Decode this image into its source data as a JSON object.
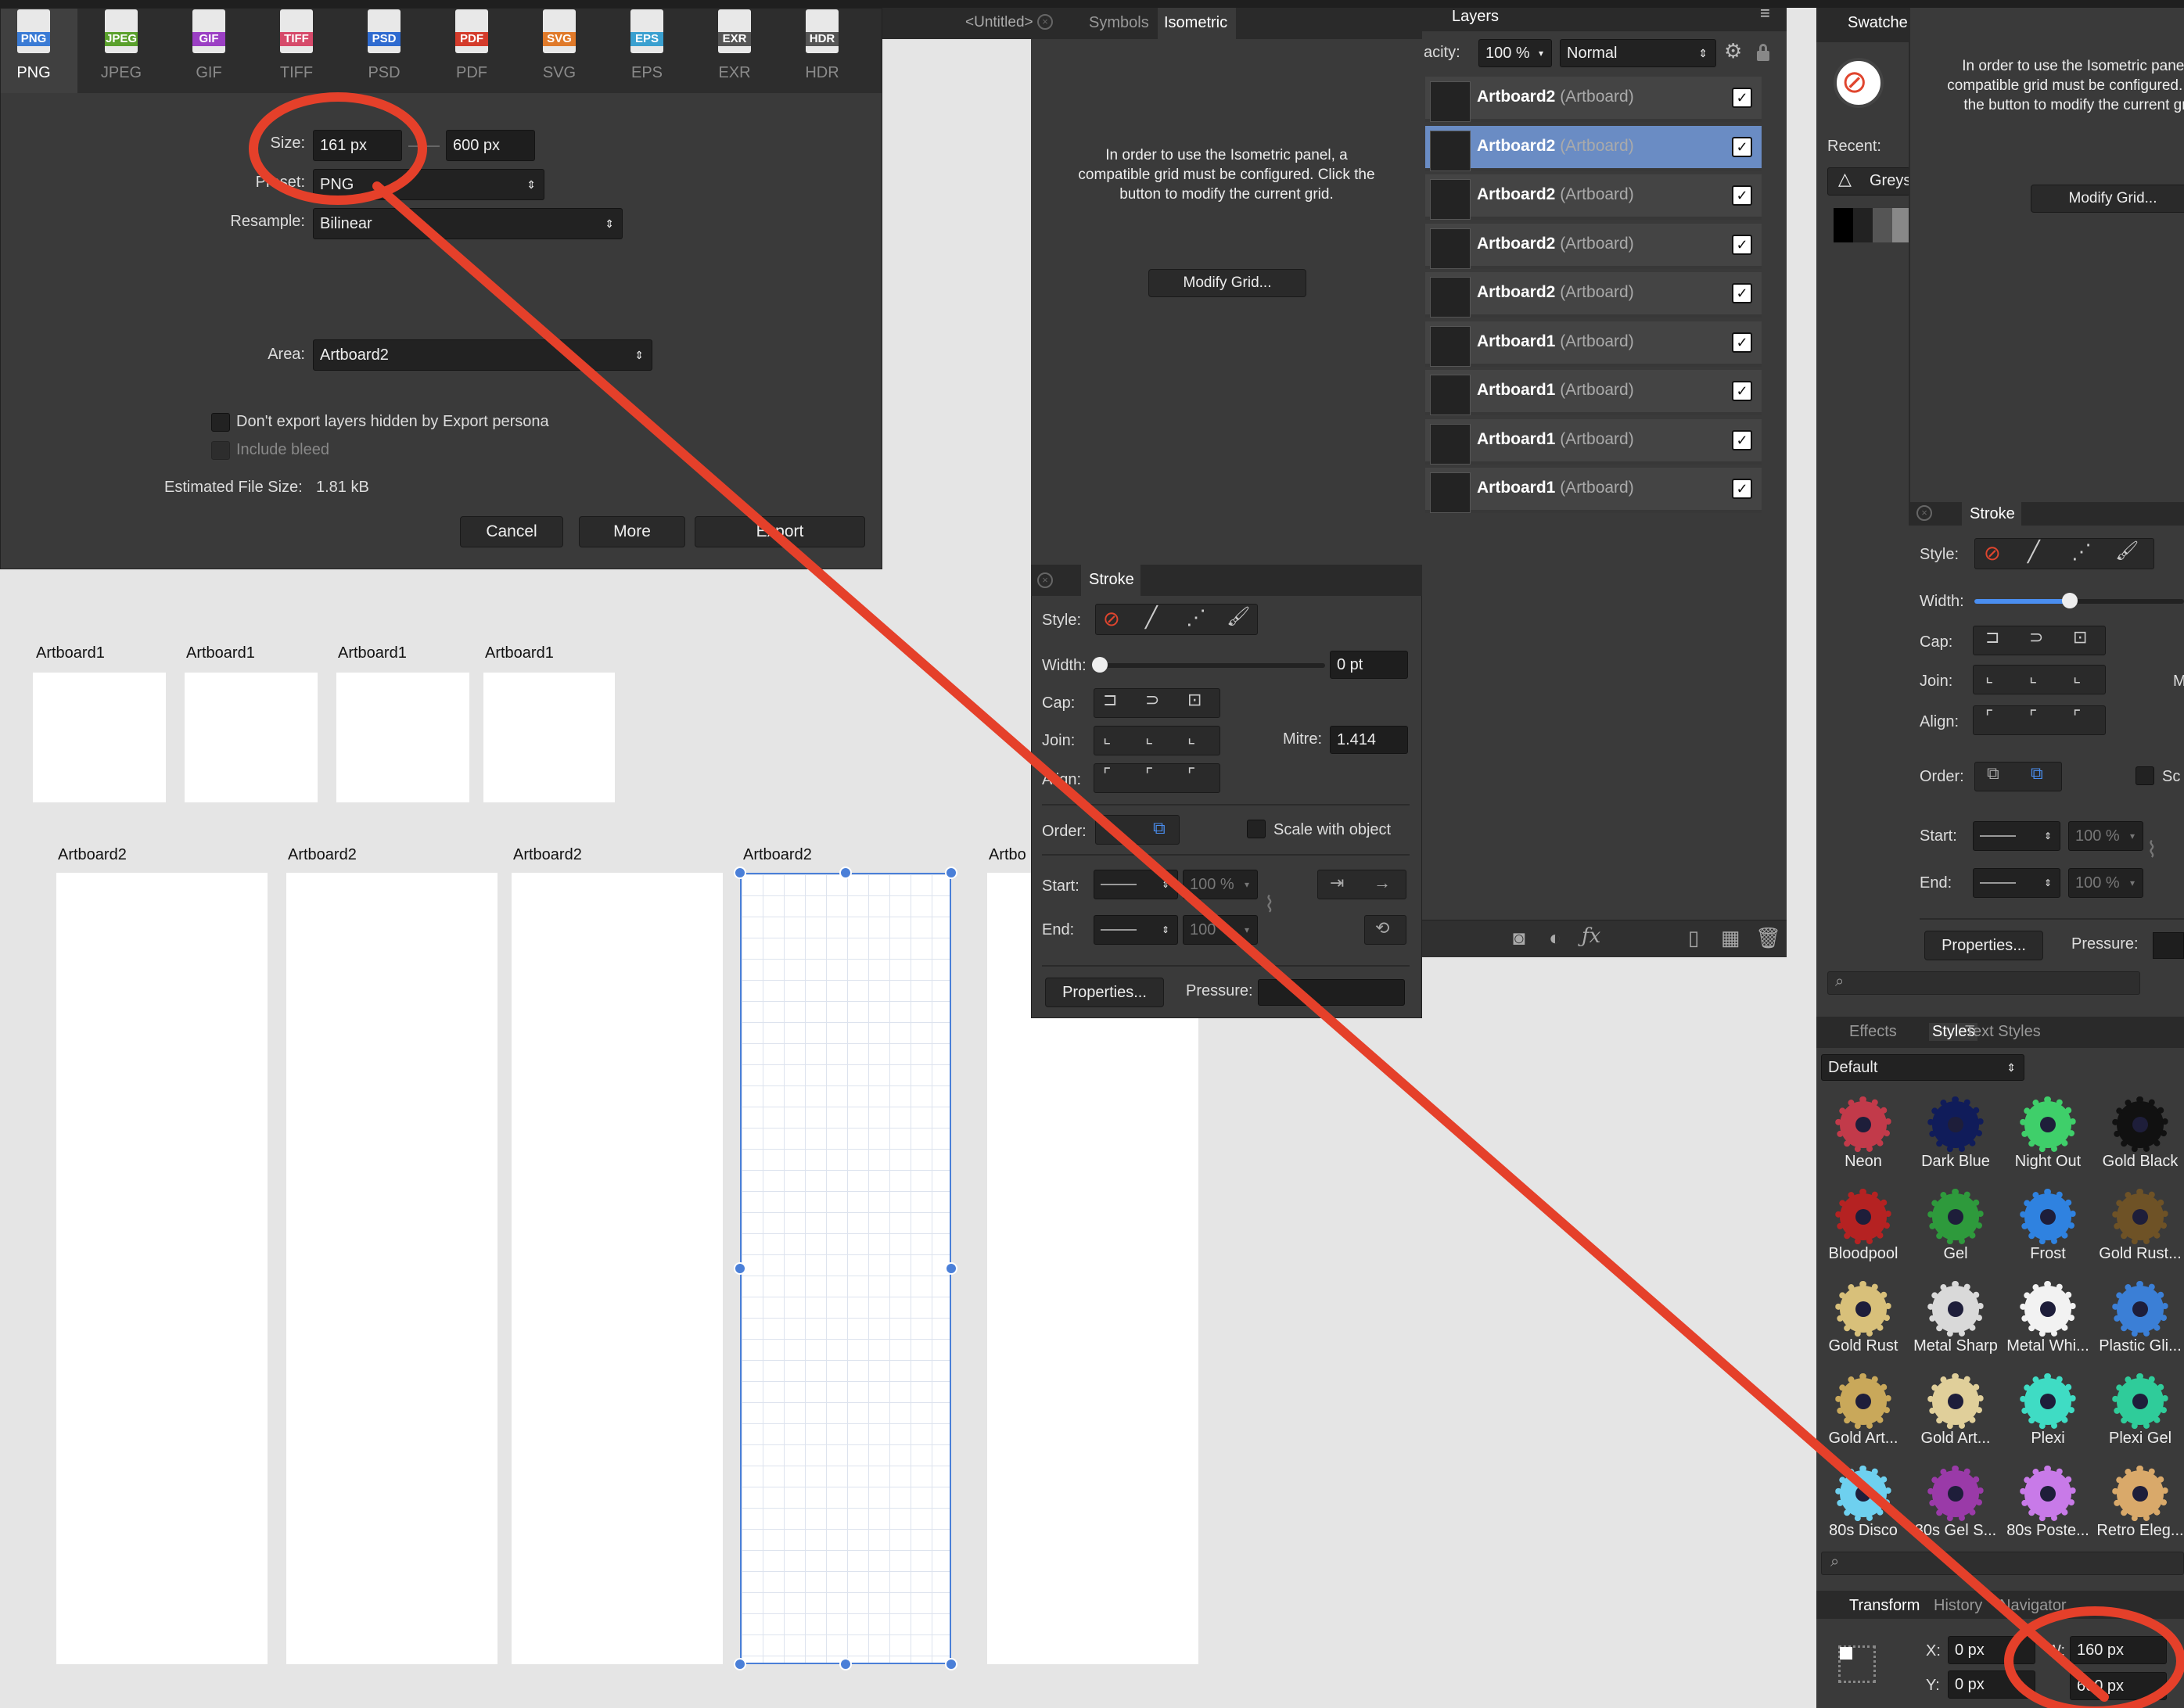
{
  "export_dialog": {
    "formats": [
      "PNG",
      "JPEG",
      "GIF",
      "TIFF",
      "PSD",
      "PDF",
      "SVG",
      "EPS",
      "EXR",
      "HDR"
    ],
    "size_label": "Size:",
    "width_value": "161 px",
    "height_value": "600 px",
    "preset_label": "Preset:",
    "preset_value": "PNG",
    "resample_label": "Resample:",
    "resample_value": "Bilinear",
    "area_label": "Area:",
    "area_value": "Artboard2",
    "hidden_layers_label": "Don't export layers hidden by Export persona",
    "include_bleed_label": "Include bleed",
    "file_size_label": "Estimated File Size:",
    "file_size_value": "1.81 kB",
    "cancel": "Cancel",
    "more": "More",
    "export": "Export"
  },
  "doc_tabs": {
    "untitled": "<Untitled>",
    "symbols": "Symbols",
    "isometric": "Isometric"
  },
  "isometric": {
    "message": "In order to use the Isometric panel, a compatible grid must be configured. Click the button to modify the current grid.",
    "modify_grid": "Modify Grid..."
  },
  "layers": {
    "title": "Layers",
    "opacity_label": "acity:",
    "opacity_value": "100 %",
    "blend_mode": "Normal",
    "rows": [
      {
        "name": "Artboard2",
        "type": "(Artboard)"
      },
      {
        "name": "Artboard2",
        "type": "(Artboard)"
      },
      {
        "name": "Artboard2",
        "type": "(Artboard)"
      },
      {
        "name": "Artboard2",
        "type": "(Artboard)"
      },
      {
        "name": "Artboard2",
        "type": "(Artboard)"
      },
      {
        "name": "Artboard1",
        "type": "(Artboard)"
      },
      {
        "name": "Artboard1",
        "type": "(Artboard)"
      },
      {
        "name": "Artboard1",
        "type": "(Artboard)"
      },
      {
        "name": "Artboard1",
        "type": "(Artboard)"
      }
    ],
    "selected_index": 1
  },
  "stroke": {
    "title": "Stroke",
    "style_label": "Style:",
    "width_label": "Width:",
    "width_value": "0 pt",
    "cap_label": "Cap:",
    "join_label": "Join:",
    "mitre_label": "Mitre:",
    "mitre_value": "1.414",
    "align_label": "Align:",
    "order_label": "Order:",
    "scale_label": "Scale with object",
    "start_label": "Start:",
    "end_label": "End:",
    "pct": "100 %",
    "pct_short": "100",
    "properties": "Properties...",
    "pressure_label": "Pressure:"
  },
  "right_stroke": {
    "title": "Stroke",
    "style_label": "Style:",
    "width_label": "Width:",
    "cap_label": "Cap:",
    "join_label": "Join:",
    "align_label": "Align:",
    "order_label": "Order:",
    "scale_label": "Sc",
    "m_label": "M",
    "start_label": "Start:",
    "end_label": "End:",
    "pct": "100 %",
    "properties": "Properties...",
    "pressure_label": "Pressure:"
  },
  "swatches": {
    "title": "Swatche",
    "recent_label": "Recent:",
    "palette": "Greys",
    "message": "In order to use the Isometric panel, a compatible grid must be configured. Click the button to modify the current grid.",
    "modify_grid": "Modify Grid..."
  },
  "styles": {
    "tabs": [
      "Effects",
      "Styles",
      "Text Styles"
    ],
    "category": "Default",
    "items": [
      {
        "name": "Neon",
        "color": "#c23a4a"
      },
      {
        "name": "Dark Blue",
        "color": "#101c5a"
      },
      {
        "name": "Night Out",
        "color": "#3fcf6a"
      },
      {
        "name": "Gold Black",
        "color": "#111111"
      },
      {
        "name": "Bloodpool",
        "color": "#b52222"
      },
      {
        "name": "Gel",
        "color": "#2e9a3c"
      },
      {
        "name": "Frost",
        "color": "#2f82e0"
      },
      {
        "name": "Gold Rust...",
        "color": "#6e5226"
      },
      {
        "name": "Gold Rust",
        "color": "#d8c07a"
      },
      {
        "name": "Metal Sharp",
        "color": "#d9d9d9"
      },
      {
        "name": "Metal Whi...",
        "color": "#f2f2f2"
      },
      {
        "name": "Plastic Gli...",
        "color": "#3b7fd6"
      },
      {
        "name": "Gold Art...",
        "color": "#c9a85a"
      },
      {
        "name": "Gold Art...",
        "color": "#e0cf9a"
      },
      {
        "name": "Plexi",
        "color": "#3fdcc4"
      },
      {
        "name": "Plexi Gel",
        "color": "#2fcc9a"
      },
      {
        "name": "80s Disco",
        "color": "#6ed0ef"
      },
      {
        "name": "80s Gel S...",
        "color": "#9a3aa8"
      },
      {
        "name": "80s Poste...",
        "color": "#c87ae8"
      },
      {
        "name": "Retro Eleg...",
        "color": "#d9a96a"
      }
    ]
  },
  "transform": {
    "tabs": [
      "Transform",
      "History",
      "Navigator"
    ],
    "x_label": "X:",
    "x_value": "0 px",
    "y_label": "Y:",
    "y_value": "0 px",
    "w_label": "W:",
    "w_value": "160 px",
    "h_value": "600 px"
  },
  "canvas": {
    "artboards1": [
      "Artboard1",
      "Artboard1",
      "Artboard1",
      "Artboard1"
    ],
    "artboards2": [
      "Artboard2",
      "Artboard2",
      "Artboard2",
      "Artboard2",
      "Artbo"
    ]
  },
  "colors": {
    "annotation": "#e5402a",
    "selection": "#4a7fd8",
    "layer_selected": "#6a8cc4"
  }
}
